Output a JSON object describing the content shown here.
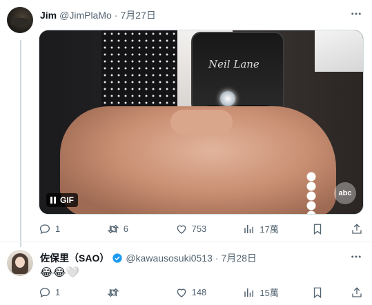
{
  "post1": {
    "author_name": "Jim",
    "author_handle": "@JimPlaMo",
    "separator": "·",
    "date": "7月27日",
    "media": {
      "brand_text": "Neil Lane",
      "network_logo": "abc",
      "gif_label": "GIF",
      "icons": {
        "pause": "pause-icon"
      }
    },
    "actions": {
      "reply_count": "1",
      "retweet_count": "6",
      "like_count": "753",
      "view_count": "17萬"
    }
  },
  "post2": {
    "author_name": "佐保里（SAO）",
    "author_handle": "@kawausosuki0513",
    "separator": "·",
    "date": "7月28日",
    "text": "😂😂🤍",
    "actions": {
      "reply_count": "1",
      "retweet_count": "",
      "like_count": "148",
      "view_count": "15萬"
    }
  },
  "colors": {
    "text": "#0f1419",
    "secondary": "#536471",
    "verified": "#1d9bf0",
    "divider": "#eff3f4"
  }
}
